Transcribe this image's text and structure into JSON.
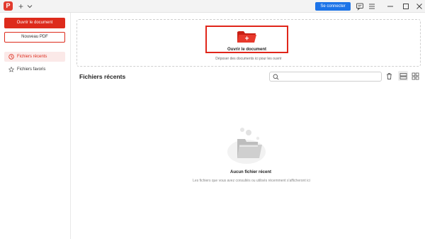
{
  "titlebar": {
    "logo_icon": "pdf-app-logo",
    "new_tab_symbol": "+",
    "signin_label": "Se connecter"
  },
  "sidebar": {
    "open_button": "Ouvrir le document",
    "new_pdf_button": "Nouveau PDF",
    "items": [
      {
        "label": "Fichiers récents",
        "icon": "clock-icon",
        "active": true
      },
      {
        "label": "Fichiers favoris",
        "icon": "star-icon",
        "active": false
      }
    ]
  },
  "dropzone": {
    "open_label": "Ouvrir le document",
    "hint": "Déposer des documents ici pour les ouvrir",
    "plus_symbol": "+"
  },
  "recent": {
    "title": "Fichiers récents",
    "search_placeholder": ""
  },
  "empty_state": {
    "title": "Aucun fichier récent",
    "description": "Les fichiers que vous avez consultés ou utilisés récemment s'afficheront ici"
  },
  "colors": {
    "accent_red": "#dd2b1c",
    "signin_blue": "#1d74e8"
  }
}
